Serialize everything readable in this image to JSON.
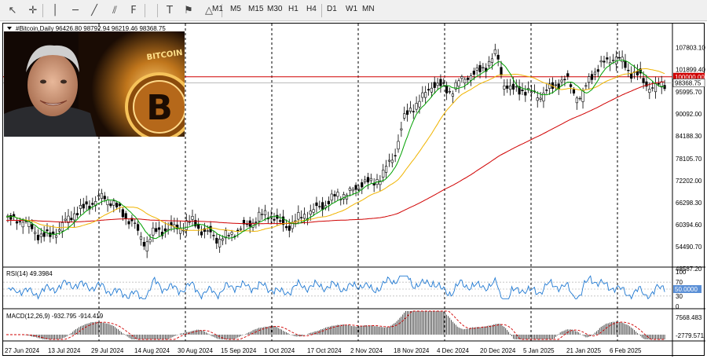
{
  "toolbar": {
    "icons": [
      "cursor-icon",
      "crosshair-icon",
      "vertical-line-icon",
      "horizontal-line-icon",
      "trendline-icon",
      "channel-icon",
      "fibonacci-icon",
      "text-icon",
      "label-icon",
      "shapes-icon"
    ],
    "timeframes": [
      "M1",
      "M5",
      "M15",
      "M30",
      "H1",
      "H4",
      "D1",
      "W1",
      "MN"
    ]
  },
  "photo": {
    "coin_text": "BITCOIN",
    "coin_symbol": "B"
  },
  "chart_data": [
    {
      "type": "candlestick",
      "title": "#Bitcoin,Daily",
      "ohlc_text": "96426.80 98792.94 96219.46 98368.75",
      "y_ticks": [
        "107803.10",
        "101899.40",
        "95995.70",
        "90092.00",
        "84188.30",
        "78105.70",
        "72202.00",
        "66298.30",
        "60394.60",
        "54490.70",
        "48587.20"
      ],
      "ylim": [
        48587.2,
        113000
      ],
      "last_price": "98368.75",
      "level_line": "100000.00",
      "x_ticks": [
        "27 Jun 2024",
        "13 Jul 2024",
        "29 Jul 2024",
        "14 Aug 2024",
        "30 Aug 2024",
        "15 Sep 2024",
        "1 Oct 2024",
        "17 Oct 2024",
        "2 Nov 2024",
        "18 Nov 2024",
        "4 Dec 2024",
        "20 Dec 2024",
        "5 Jan 2025",
        "21 Jan 2025",
        "6 Feb 2025"
      ],
      "close_path": [
        [
          0,
          62000
        ],
        [
          10,
          61500
        ],
        [
          20,
          58000
        ],
        [
          28,
          57500
        ],
        [
          35,
          59000
        ],
        [
          45,
          63500
        ],
        [
          55,
          66000
        ],
        [
          62,
          67500
        ],
        [
          70,
          66500
        ],
        [
          78,
          63000
        ],
        [
          84,
          61000
        ],
        [
          88,
          57000
        ],
        [
          92,
          55000
        ],
        [
          98,
          58500
        ],
        [
          106,
          59500
        ],
        [
          116,
          59500
        ],
        [
          124,
          61500
        ],
        [
          130,
          58500
        ],
        [
          136,
          58000
        ],
        [
          140,
          56000
        ],
        [
          146,
          57000
        ],
        [
          152,
          59000
        ],
        [
          160,
          60500
        ],
        [
          168,
          62500
        ],
        [
          176,
          63000
        ],
        [
          180,
          61000
        ],
        [
          186,
          60000
        ],
        [
          192,
          61500
        ],
        [
          200,
          63500
        ],
        [
          208,
          65500
        ],
        [
          216,
          67500
        ],
        [
          224,
          68500
        ],
        [
          230,
          69500
        ],
        [
          236,
          72500
        ],
        [
          242,
          71000
        ],
        [
          248,
          73500
        ],
        [
          256,
          78500
        ],
        [
          262,
          88500
        ],
        [
          268,
          91500
        ],
        [
          276,
          94500
        ],
        [
          282,
          98500
        ],
        [
          288,
          97500
        ],
        [
          294,
          96000
        ],
        [
          300,
          98500
        ],
        [
          306,
          100500
        ],
        [
          312,
          101500
        ],
        [
          318,
          103500
        ],
        [
          324,
          106000
        ],
        [
          328,
          98500
        ],
        [
          334,
          96500
        ],
        [
          340,
          97000
        ],
        [
          346,
          95500
        ],
        [
          352,
          94500
        ],
        [
          358,
          96500
        ],
        [
          364,
          98500
        ],
        [
          370,
          99500
        ],
        [
          376,
          95000
        ],
        [
          380,
          94000
        ],
        [
          386,
          100500
        ],
        [
          392,
          103000
        ],
        [
          398,
          104500
        ],
        [
          402,
          105000
        ],
        [
          408,
          103500
        ],
        [
          412,
          101500
        ],
        [
          418,
          100500
        ],
        [
          424,
          97500
        ],
        [
          428,
          96500
        ],
        [
          433,
          98000
        ],
        [
          436,
          98368
        ]
      ],
      "series": [
        {
          "name": "MA short",
          "color": "#00a000"
        },
        {
          "name": "MA medium",
          "color": "#f0b400"
        },
        {
          "name": "MA long",
          "color": "#d00000"
        }
      ]
    },
    {
      "type": "line",
      "title": "RSI(14) 49.3984",
      "y_ticks": [
        "100",
        "70",
        "50.0000",
        "30",
        "0"
      ],
      "ylim": [
        0,
        100
      ],
      "levels": [
        70,
        50,
        30
      ],
      "color": "#1e78d2"
    },
    {
      "type": "histogram",
      "title": "MACD(12,26,9) -932.795 -914.419",
      "y_ticks": [
        "7568.483",
        "-2779.571"
      ],
      "hist_color": "#000000",
      "signal_color": "#d00000"
    }
  ]
}
